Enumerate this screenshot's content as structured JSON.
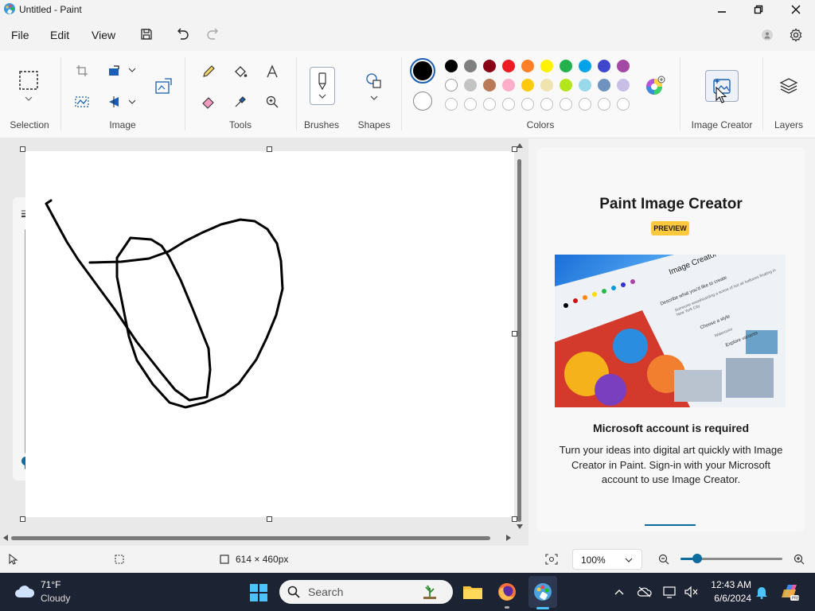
{
  "window": {
    "title": "Untitled - Paint"
  },
  "menu": {
    "file": "File",
    "edit": "Edit",
    "view": "View"
  },
  "ribbon": {
    "groups": {
      "selection": "Selection",
      "image": "Image",
      "tools": "Tools",
      "brushes": "Brushes",
      "shapes": "Shapes",
      "colors": "Colors",
      "image_creator": "Image Creator",
      "layers": "Layers"
    },
    "active_color": "#000000",
    "secondary_color": "#ffffff",
    "palette_row1": [
      "#000000",
      "#7f7f7f",
      "#880015",
      "#ed1c24",
      "#ff7f27",
      "#fff200",
      "#22b14c",
      "#00a2e8",
      "#3f48cc",
      "#a349a4"
    ],
    "palette_row2": [
      "#ffffff",
      "#c3c3c3",
      "#b97a57",
      "#ffaec9",
      "#ffc90e",
      "#efe4b0",
      "#b5e61d",
      "#99d9ea",
      "#7092be",
      "#c8bfe7"
    ]
  },
  "panel": {
    "title": "Paint Image Creator",
    "badge": "PREVIEW",
    "heading": "Microsoft account is required",
    "body": "Turn your ideas into digital art quickly with Image Creator in Paint. Sign-in with your Microsoft account to use Image Creator.",
    "promo_title": "Image Creator",
    "promo_prompt_label": "Describe what you'd like to create",
    "promo_prompt_text": "Someone snowboarding a scene of hot air balloons floating in New York City",
    "promo_style_label": "Choose a style",
    "promo_style_value": "Watercolor",
    "promo_variants_label": "Explore variants"
  },
  "status": {
    "canvas_size": "614 × 460px",
    "zoom": "100%"
  },
  "taskbar": {
    "temperature": "71°F",
    "weather": "Cloudy",
    "search_placeholder": "Search",
    "time": "12:43 AM",
    "date": "6/6/2024"
  }
}
